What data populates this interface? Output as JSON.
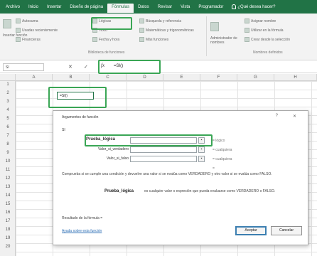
{
  "ribbon_tabs": [
    "Archivo",
    "Inicio",
    "Insertar",
    "Diseño de página",
    "Fórmulas",
    "Datos",
    "Revisar",
    "Vista",
    "Programador"
  ],
  "active_tab_index": 4,
  "tell_me": "¿Qué desea hacer?",
  "ribbon": {
    "autosum": "Autosuma",
    "recent": "Usadas recientemente",
    "financial": "Financieras",
    "insert_function": "Insertar función",
    "logical": "Lógicas",
    "text": "Texto",
    "date_time": "Fecha y hora",
    "lookup": "Búsqueda y referencia",
    "math": "Matemáticas y trigonométricas",
    "more": "Más funciones",
    "name_manager": "Administrador de nombres",
    "define_name": "Asignar nombre",
    "use_in_formula": "Utilizar en la fórmula",
    "create_from_selection": "Crear desde la selección",
    "group_library": "Biblioteca de funciones",
    "group_names": "Nombres definidos"
  },
  "formula_bar": {
    "name_box": "SI",
    "cancel": "✕",
    "enter": "✓",
    "fx": "fx",
    "content": "=SI()"
  },
  "columns": [
    "A",
    "B",
    "C",
    "D",
    "E",
    "F",
    "G",
    "H"
  ],
  "rows": [
    "1",
    "2",
    "3",
    "4",
    "5",
    "6",
    "7",
    "8",
    "9",
    "10",
    "11",
    "12",
    "13",
    "14",
    "15",
    "16",
    "17",
    "18",
    "19",
    "20"
  ],
  "active_cell": {
    "value": "=SI()"
  },
  "dialog": {
    "title": "Argumentos de función",
    "help": "?",
    "close": "✕",
    "function_name": "SI",
    "args": [
      {
        "label": "Prueba_lógica",
        "value": "",
        "result": "= lógico"
      },
      {
        "label": "Valor_si_verdadero",
        "value": "",
        "result": "= cualquiera"
      },
      {
        "label": "Valor_si_falso",
        "value": "",
        "result": "= cualquiera"
      }
    ],
    "result_eq": "=",
    "description": "Comprueba si se cumple una condición y devuelve una valor si se evalúa como VERDADERO y otro valor si se evalúa como FALSO.",
    "param_label": "Prueba_lógica",
    "param_description": "es cualquier valor o expresión que pueda evaluarse como VERDADERO o FALSO.",
    "result_label": "Resultado de la fórmula =",
    "help_link": "Ayuda sobre esta función",
    "ok": "Aceptar",
    "cancel": "Cancelar"
  },
  "colors": {
    "excel_green": "#217346",
    "highlight": "#3aa655"
  }
}
